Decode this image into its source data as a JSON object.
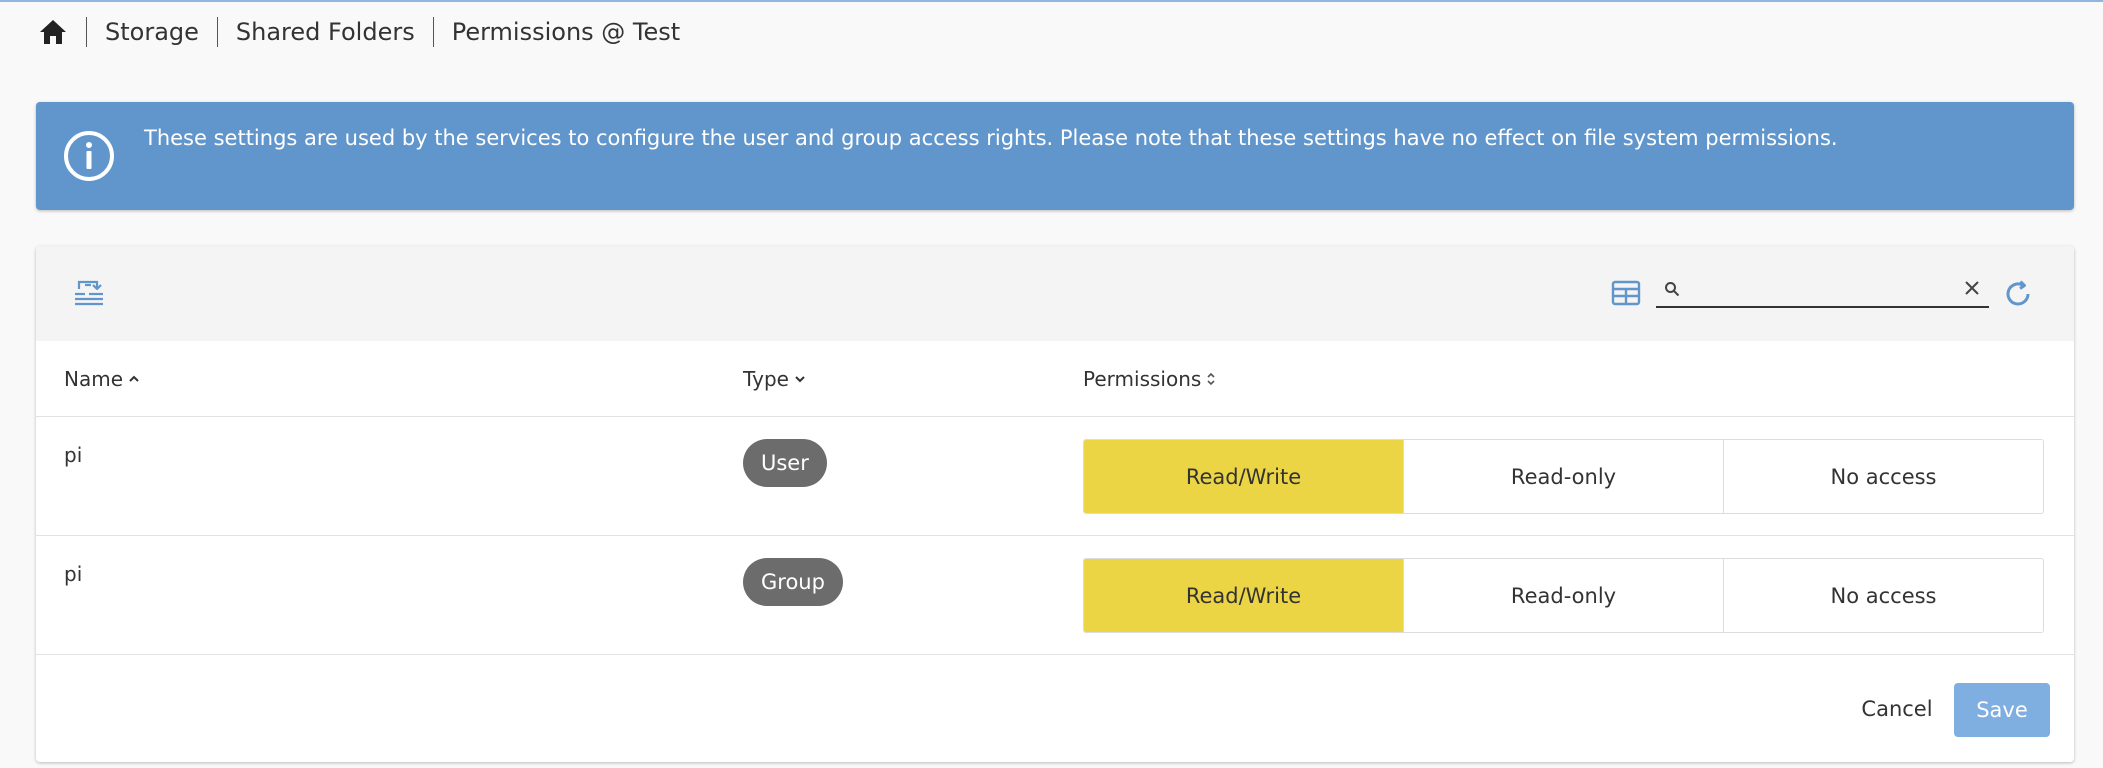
{
  "breadcrumb": {
    "home_icon": "home-icon",
    "items": [
      "Storage",
      "Shared Folders",
      "Permissions @ Test"
    ]
  },
  "alert": {
    "icon": "info-icon",
    "text": "These settings are used by the services to configure the user and group access rights. Please note that these settings have no effect on file system permissions."
  },
  "toolbar": {
    "left_icon": "shared-folder-privileges-icon",
    "column_toggle_icon": "table-columns-icon",
    "search": {
      "icon": "search-icon",
      "value": "",
      "placeholder": ""
    },
    "clear_icon": "close-icon",
    "reload_icon": "refresh-icon"
  },
  "table": {
    "columns": [
      {
        "label": "Name",
        "sort": "asc"
      },
      {
        "label": "Type",
        "sort": "desc"
      },
      {
        "label": "Permissions",
        "sort": "none"
      }
    ],
    "rows": [
      {
        "name": "pi",
        "type": "User",
        "options": [
          "Read/Write",
          "Read-only",
          "No access"
        ],
        "selected": "Read/Write"
      },
      {
        "name": "pi",
        "type": "Group",
        "options": [
          "Read/Write",
          "Read-only",
          "No access"
        ],
        "selected": "Read/Write"
      }
    ]
  },
  "footer": {
    "cancel_label": "Cancel",
    "save_label": "Save"
  },
  "colors": {
    "accent": "#6196cc",
    "selected_permission": "#ecd544",
    "badge": "#6c6c6c",
    "save_button": "#7faee0"
  }
}
